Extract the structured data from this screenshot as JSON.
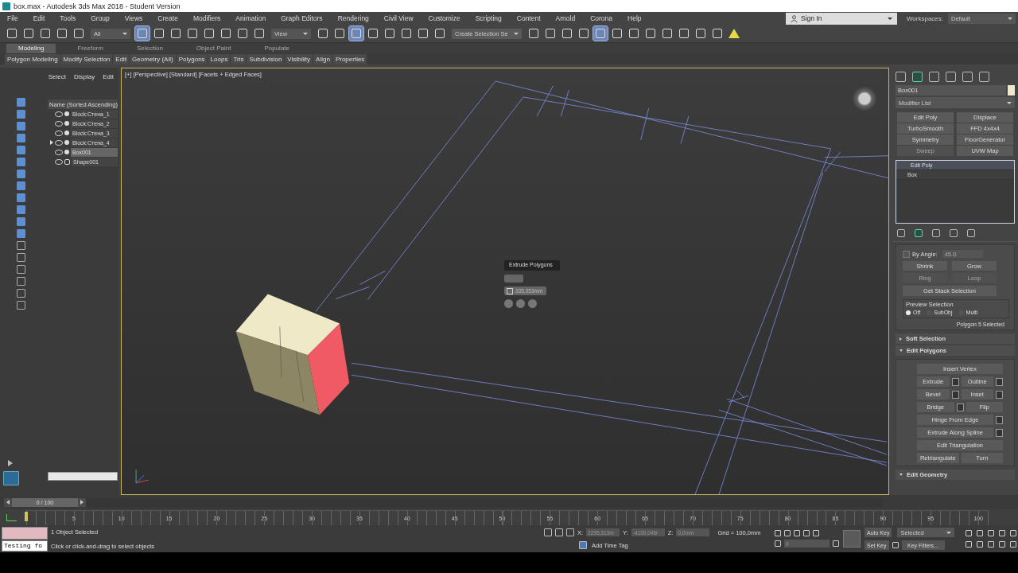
{
  "window": {
    "title": "box.max - Autodesk 3ds Max 2018 - Student Version"
  },
  "menu": [
    "File",
    "Edit",
    "Tools",
    "Group",
    "Views",
    "Create",
    "Modifiers",
    "Animation",
    "Graph Editors",
    "Rendering",
    "Civil View",
    "Customize",
    "Scripting",
    "Content",
    "Arnold",
    "Corona",
    "Help"
  ],
  "account": {
    "sign_in": "Sign In",
    "workspaces_label": "Workspaces:",
    "workspace": "Default"
  },
  "toolbar": {
    "selection_filter": "All",
    "reference_coord": "View",
    "named_selection": "Create Selection Se"
  },
  "ribbon": {
    "tabs": [
      {
        "label": "Modeling",
        "selected": true
      },
      {
        "label": "Freeform",
        "selected": false
      },
      {
        "label": "Selection",
        "selected": false
      },
      {
        "label": "Object Paint",
        "selected": false
      },
      {
        "label": "Populate",
        "selected": false
      }
    ],
    "panels": [
      "Polygon Modeling",
      "Modify Selection",
      "Edit",
      "Geometry (All)",
      "Polygons",
      "Loops",
      "Tris",
      "Subdivision",
      "Visibility",
      "Align",
      "Properties"
    ]
  },
  "scene_explorer": {
    "tabs": [
      "Select",
      "Display",
      "Edit"
    ],
    "column": "Name (Sorted Ascending)",
    "items": [
      {
        "name": "Block:Стена_1",
        "kind": "object",
        "selected": false,
        "expandable": false
      },
      {
        "name": "Block:Стена_2",
        "kind": "object",
        "selected": false,
        "expandable": false
      },
      {
        "name": "Block:Стена_3",
        "kind": "object",
        "selected": false,
        "expandable": false
      },
      {
        "name": "Block:Стена_4",
        "kind": "object",
        "selected": false,
        "expandable": true
      },
      {
        "name": "Box001",
        "kind": "object",
        "selected": true,
        "expandable": false
      },
      {
        "name": "Shape001",
        "kind": "shape",
        "selected": false,
        "expandable": false
      }
    ]
  },
  "viewport": {
    "labels": [
      "[+]",
      "[Perspective]",
      "[Standard]",
      "[Facets + Edged Faces]"
    ],
    "caddy": {
      "title": "Extrude Polygons",
      "value": "335,053mm"
    }
  },
  "command_panel": {
    "object_name": "Box001",
    "modifier_list": "Modifier List",
    "modifier_buttons": [
      {
        "label": "Edit Poly",
        "disabled": false
      },
      {
        "label": "Displace",
        "disabled": false
      },
      {
        "label": "TurboSmooth",
        "disabled": false
      },
      {
        "label": "FFD 4x4x4",
        "disabled": false
      },
      {
        "label": "Symmetry",
        "disabled": false
      },
      {
        "label": "FloorGenerator",
        "disabled": false
      },
      {
        "label": "Sweep",
        "disabled": true
      },
      {
        "label": "UVW Map",
        "disabled": false
      }
    ],
    "stack": [
      {
        "label": "Edit Poly",
        "kind": "modifier",
        "selected": true
      },
      {
        "label": "Box",
        "kind": "base",
        "selected": false
      }
    ],
    "selection": {
      "by_angle": {
        "label": "By Angle:",
        "checked": false,
        "value": "45.0"
      },
      "buttons": [
        {
          "label": "Shrink",
          "disabled": false
        },
        {
          "label": "Grow",
          "disabled": false
        },
        {
          "label": "Ring",
          "disabled": true
        },
        {
          "label": "Loop",
          "disabled": true
        }
      ],
      "stack_button": "Get Stack Selection",
      "preview": {
        "title": "Preview Selection",
        "options": [
          {
            "label": "Off",
            "selected": true
          },
          {
            "label": "SubObj",
            "selected": false
          },
          {
            "label": "Multi",
            "selected": false
          }
        ]
      },
      "status": "Polygon 5 Selected"
    },
    "rollouts": [
      {
        "title": "Soft Selection",
        "expanded": false
      },
      {
        "title": "Edit Polygons",
        "expanded": true,
        "rows": [
          {
            "buttons": [
              {
                "label": "Insert Vertex",
                "settings": false
              }
            ]
          },
          {
            "buttons": [
              {
                "label": "Extrude",
                "settings": true
              },
              {
                "label": "Outline",
                "settings": true
              }
            ]
          },
          {
            "buttons": [
              {
                "label": "Bevel",
                "settings": true
              },
              {
                "label": "Inset",
                "settings": true
              }
            ]
          },
          {
            "buttons": [
              {
                "label": "Bridge",
                "settings": true
              },
              {
                "label": "Flip",
                "settings": false
              }
            ]
          },
          {
            "buttons": [
              {
                "label": "Hinge From Edge",
                "settings": true
              }
            ]
          },
          {
            "buttons": [
              {
                "label": "Extrude Along Spline",
                "settings": true
              }
            ]
          },
          {
            "buttons": [
              {
                "label": "Edit Triangulation",
                "settings": false
              }
            ]
          },
          {
            "buttons": [
              {
                "label": "Retriangulate",
                "settings": false
              },
              {
                "label": "Turn",
                "settings": false
              }
            ]
          }
        ]
      },
      {
        "title": "Edit Geometry",
        "expanded": true
      }
    ]
  },
  "timeline": {
    "slider": "0 / 100",
    "level": 0,
    "ticks": [
      "5",
      "10",
      "15",
      "20",
      "25",
      "30",
      "35",
      "40",
      "45",
      "50",
      "55",
      "60",
      "65",
      "70",
      "75",
      "80",
      "85",
      "90",
      "95",
      "100"
    ]
  },
  "status_bar": {
    "script_field": "Testing fo",
    "selection": "1 Object Selected",
    "prompt": "Click or click-and-drag to select objects",
    "coords": [
      {
        "axis": "X:",
        "value": "2295,313m"
      },
      {
        "axis": "Y:",
        "value": "-4100,045r"
      },
      {
        "axis": "Z:",
        "value": "0,0mm"
      }
    ],
    "grid": "Grid = 100,0mm",
    "time_tag": "Add Time Tag",
    "frame": "0",
    "auto_key": "Auto Key",
    "key_mode": "Selected",
    "set_key": "Set Key",
    "key_filters": "Key Filters..."
  }
}
